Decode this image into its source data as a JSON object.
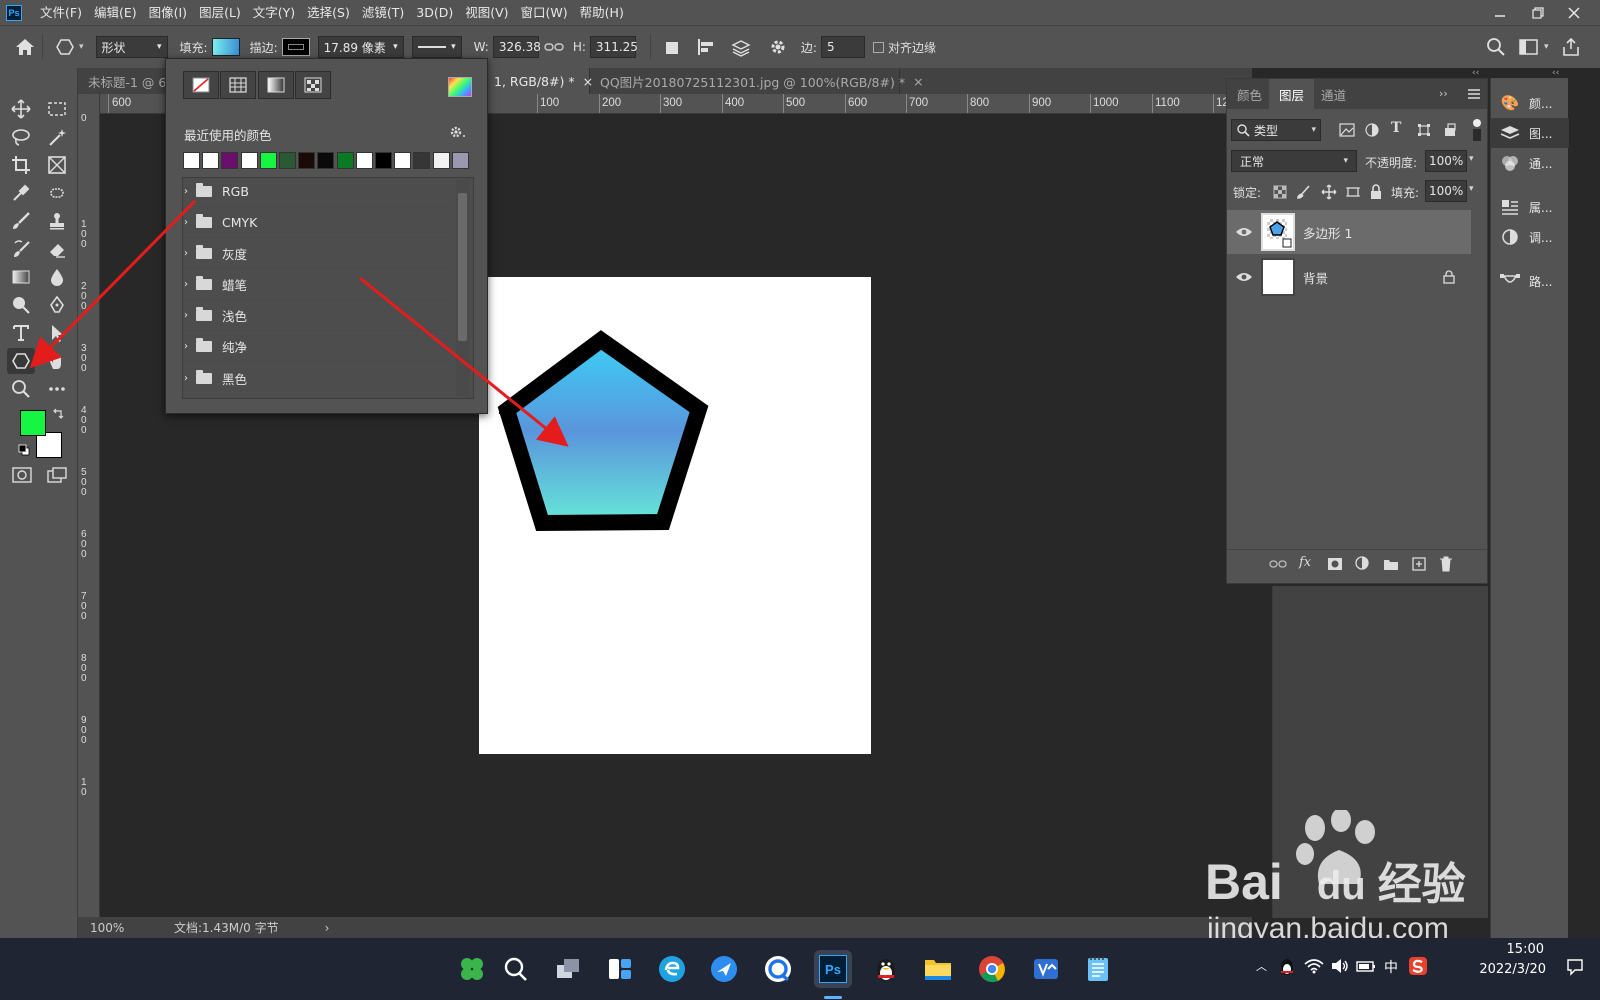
{
  "menu": {
    "logo": "Ps",
    "items": [
      "文件(F)",
      "编辑(E)",
      "图像(I)",
      "图层(L)",
      "文字(Y)",
      "选择(S)",
      "滤镜(T)",
      "3D(D)",
      "视图(V)",
      "窗口(W)",
      "帮助(H)"
    ]
  },
  "options": {
    "mode": "形状",
    "fill_label": "填充:",
    "stroke_label": "描边:",
    "stroke_size": "17.89 像素",
    "w_label": "W:",
    "w_value": "326.38",
    "h_label": "H:",
    "h_value": "311.25",
    "sides_label": "边:",
    "sides_value": "5",
    "align_edges": "对齐边缘"
  },
  "tabs": [
    {
      "label": "未标题-1 @ 6"
    },
    {
      "label": "1, RGB/8#) *",
      "close": "×"
    },
    {
      "label": "QQ图片20180725112301.jpg @ 100%(RGB/8#) *",
      "close": "×"
    }
  ],
  "ruler": {
    "h_labels": [
      "600",
      "100",
      "200",
      "300",
      "400",
      "500",
      "600",
      "700",
      "800",
      "900",
      "1000",
      "1100",
      "12"
    ],
    "v_labels": [
      "0",
      "1 0 0",
      "2 0 0",
      "3 0 0",
      "4 0 0",
      "5 0 0",
      "6 0 0",
      "7 0 0",
      "8 0 0",
      "9 0 0",
      "1 0"
    ]
  },
  "swatch_popup": {
    "recent_label": "最近使用的颜色",
    "recent_colors": [
      "#ffffff",
      "#ffffff",
      "#6b0f6e",
      "#ffffff",
      "#16f542",
      "#2a5a33",
      "#1a0a08",
      "#0a0a0a",
      "#0c7a22",
      "#ffffff",
      "#000000",
      "#ffffff",
      "#363636",
      "#f2f2f2",
      "#9898b0"
    ],
    "groups": [
      "RGB",
      "CMYK",
      "灰度",
      "蜡笔",
      "浅色",
      "纯净",
      "黑色"
    ]
  },
  "layers_panel": {
    "tabs": [
      "颜色",
      "图层",
      "通道"
    ],
    "filter_kind": "类型",
    "blend_mode": "正常",
    "opacity_label": "不透明度:",
    "opacity_value": "100%",
    "lock_label": "锁定:",
    "fill_label": "填充:",
    "fill_value": "100%",
    "layers": [
      {
        "name": "多边形 1"
      },
      {
        "name": "背景"
      }
    ],
    "footer_fx": "fx"
  },
  "right_dock": {
    "items": [
      "颜...",
      "图...",
      "通...",
      "属...",
      "调...",
      "路..."
    ]
  },
  "status": {
    "zoom": "100%",
    "doc": "文档:1.43M/0 字节",
    "arrow": "›"
  },
  "taskbar": {
    "time": "15:00",
    "date": "2022/3/20",
    "ime": "中",
    "ps_label": "Ps"
  },
  "watermark": {
    "brand": "Bai",
    "brand2": "du",
    "cn": "经验",
    "url": "jingyan.baidu.com"
  },
  "colors": {
    "foreground": "#16f542",
    "background": "#ffffff",
    "annotation_arrow": "#e51c1c"
  }
}
